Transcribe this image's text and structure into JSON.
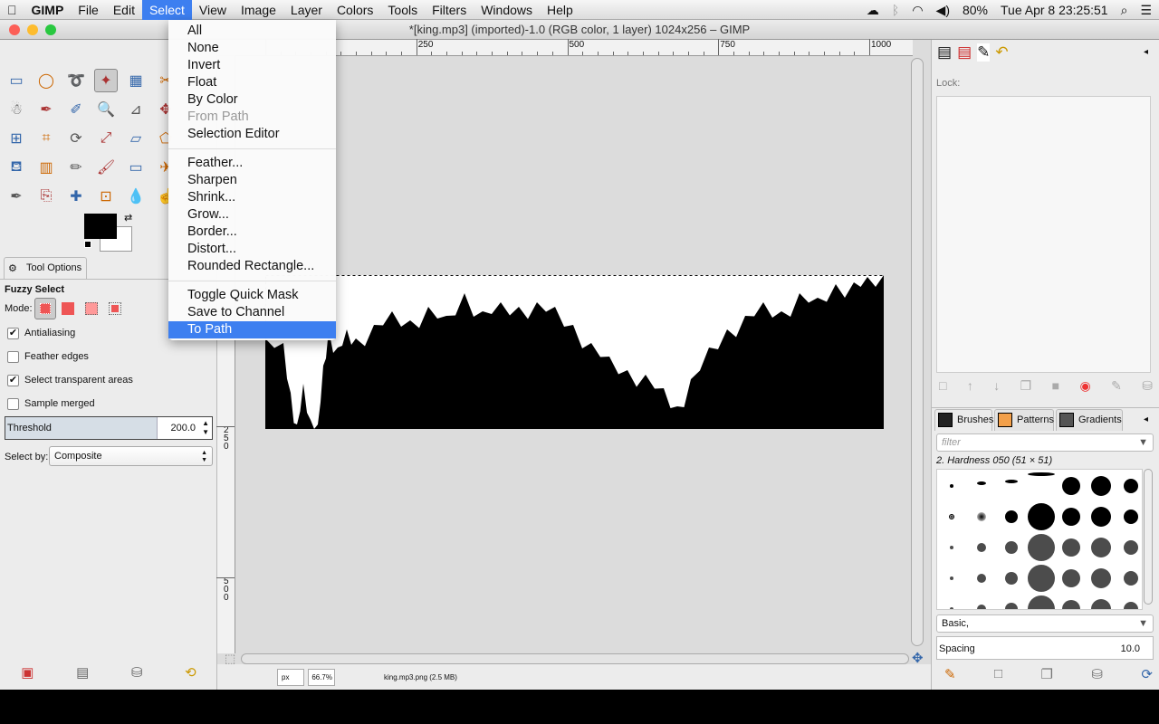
{
  "menubar": {
    "app": "GIMP",
    "items": [
      "File",
      "Edit",
      "Select",
      "View",
      "Image",
      "Layer",
      "Colors",
      "Tools",
      "Filters",
      "Windows",
      "Help"
    ],
    "active": "Select",
    "status": {
      "battery": "80%",
      "clock": "Tue Apr 8  23:25:51"
    }
  },
  "window": {
    "title": "*[king.mp3] (imported)-1.0 (RGB color, 1 layer) 1024x256 – GIMP"
  },
  "select_menu": {
    "groups": [
      [
        {
          "label": "All"
        },
        {
          "label": "None"
        },
        {
          "label": "Invert"
        },
        {
          "label": "Float"
        },
        {
          "label": "By Color"
        },
        {
          "label": "From Path",
          "disabled": true
        },
        {
          "label": "Selection Editor"
        }
      ],
      [
        {
          "label": "Feather..."
        },
        {
          "label": "Sharpen"
        },
        {
          "label": "Shrink..."
        },
        {
          "label": "Grow..."
        },
        {
          "label": "Border..."
        },
        {
          "label": "Distort..."
        },
        {
          "label": "Rounded Rectangle..."
        }
      ],
      [
        {
          "label": "Toggle Quick Mask"
        },
        {
          "label": "Save to Channel"
        },
        {
          "label": "To Path",
          "highlighted": true
        }
      ]
    ]
  },
  "tool_options": {
    "tab": "Tool Options",
    "tool": "Fuzzy Select",
    "mode_label": "Mode:",
    "checks": [
      {
        "label": "Antialiasing",
        "checked": true
      },
      {
        "label": "Feather edges",
        "checked": false
      },
      {
        "label": "Select transparent areas",
        "checked": true
      },
      {
        "label": "Sample merged",
        "checked": false
      }
    ],
    "threshold": {
      "label": "Threshold",
      "value": "200.0",
      "fraction": 0.78
    },
    "select_by": {
      "label": "Select by:",
      "value": "Composite"
    }
  },
  "rulers": {
    "top": [
      "250",
      "500",
      "750",
      "1000"
    ],
    "left": [
      "250",
      "500"
    ]
  },
  "statusbar": {
    "unit": "px",
    "zoom": "66.7%",
    "file": "king.mp3.png (2.5 MB)"
  },
  "layers": {
    "lock_label": "Lock:"
  },
  "brushes": {
    "tabs": [
      "Brushes",
      "Patterns",
      "Gradients"
    ],
    "filter_placeholder": "filter",
    "current": "2. Hardness 050 (51 × 51)",
    "preset": "Basic,",
    "spacing": {
      "label": "Spacing",
      "value": "10.0"
    }
  },
  "colors": {
    "accent": "#3d7ff0",
    "fg": "#000000",
    "bg": "#ffffff"
  }
}
